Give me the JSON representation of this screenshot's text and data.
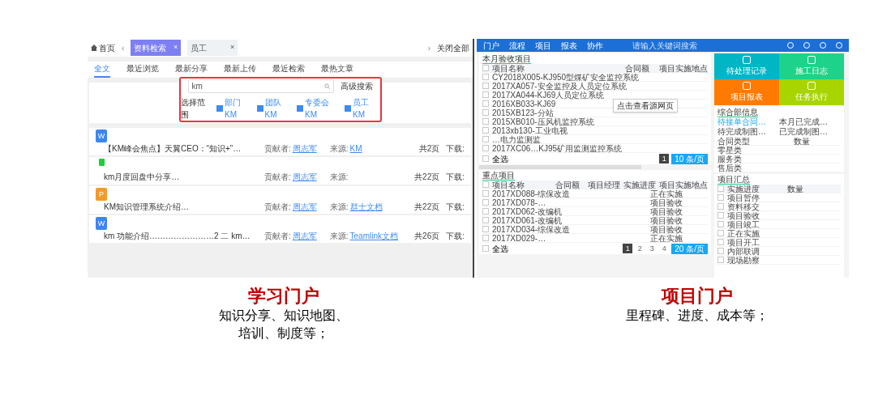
{
  "learning_portal": {
    "top_bar": {
      "home": "首页",
      "prev": "‹",
      "tabs": [
        {
          "label": "资料检索",
          "selected": true
        },
        {
          "label": "员工",
          "selected": false
        }
      ],
      "close": "×",
      "next": "›",
      "close_all": "关闭全部"
    },
    "nav": [
      {
        "label": "全文",
        "selected": true
      },
      {
        "label": "最近浏览",
        "selected": false
      },
      {
        "label": "最新分享",
        "selected": false
      },
      {
        "label": "最新上传",
        "selected": false
      },
      {
        "label": "最近检索",
        "selected": false
      },
      {
        "label": "最热文章",
        "selected": false
      }
    ],
    "search": {
      "value": "km",
      "advanced": "高级搜索",
      "scope_label": "选择范围",
      "scopes": [
        {
          "label": "部门KM",
          "checked": true
        },
        {
          "label": "团队KM",
          "checked": true
        },
        {
          "label": "专委会KM",
          "checked": true
        },
        {
          "label": "员工KM",
          "checked": true
        }
      ]
    },
    "results": [
      {
        "kind": "word",
        "badge": "W",
        "title": "【KM峰会焦点】天翼CEO：“知识+”…",
        "contributor_label": "贡献者:",
        "contributor": "周志军",
        "source_label": "来源:",
        "source": "KM",
        "pages": "共2页",
        "download": "下载:"
      },
      {
        "kind": "sheet",
        "title": "km月度回盘中分享…",
        "contributor_label": "贡献者:",
        "contributor": "周志军",
        "source_label": "来源:",
        "pages": "共22页",
        "download": "下载:"
      },
      {
        "kind": "slides",
        "badge": "P",
        "title": "KM知识管理系统介绍…",
        "contributor_label": "贡献者:",
        "contributor": "周志军",
        "source_label": "来源:",
        "source": "群士文档",
        "pages": "共22页",
        "download": "下载:"
      },
      {
        "kind": "word",
        "badge": "W",
        "title": "km 功能介绍……………………2 二 km…",
        "contributor_label": "贡献者:",
        "contributor": "周志军",
        "source_label": "来源:",
        "source": "Teamlink文档",
        "pages": "共26页",
        "download": "下载:"
      }
    ]
  },
  "project_portal": {
    "menu": [
      "门户",
      "流程",
      "项目",
      "报表",
      "协作"
    ],
    "search_placeholder": "请输入关键词搜索",
    "monthly": {
      "title": "本月验收项目",
      "header_checked": false,
      "columns": [
        "项目名称",
        "合同额",
        "项目实施地点"
      ],
      "rows": [
        {
          "name": "CY2018X005-KJ950型煤矿安全监控系统",
          "checked": false
        },
        {
          "name": "2017XA057-安全监控及人员定位系统",
          "checked": false
        },
        {
          "name": "2017XA044-KJ69人员定位系统",
          "checked": false
        },
        {
          "name": "2016XB033-KJ69",
          "checked": false
        },
        {
          "name": "2015XB123-分站",
          "checked": false
        },
        {
          "name": "2015XB010-压风机监控系统",
          "checked": false
        },
        {
          "name": "2013xb130-工业电视",
          "checked": false
        },
        {
          "name": "…电力监测监",
          "checked": false
        },
        {
          "name": "2017XC06…KJ95矿用监测监控系统",
          "checked": false
        }
      ],
      "tooltip": "点击查看源网页",
      "select_all": {
        "label": "全选",
        "checked": false
      },
      "pages": [
        {
          "label": "1",
          "selected": true
        }
      ],
      "page_size": "10 条/页"
    },
    "key": {
      "title": "重点项目",
      "header_checked": false,
      "columns": [
        "项目名称",
        "合同额",
        "项目经理",
        "实施进度",
        "项目实施地点"
      ],
      "rows": [
        {
          "name": "2017XD088-综保改造",
          "progress": "正在实施",
          "checked": false
        },
        {
          "name": "2017XD078-…",
          "progress": "项目验收",
          "checked": false
        },
        {
          "name": "2017XD062-改编机",
          "progress": "项目验收",
          "checked": false
        },
        {
          "name": "2017XD061-改编机",
          "progress": "项目验收",
          "checked": false
        },
        {
          "name": "2017XD034-综保改造",
          "progress": "项目验收",
          "checked": false
        },
        {
          "name": "2017XD029-…",
          "progress": "正在实施",
          "checked": false
        }
      ],
      "select_all": {
        "label": "全选",
        "checked": false
      },
      "pages": [
        {
          "label": "1",
          "selected": true
        },
        {
          "label": "2",
          "selected": false
        },
        {
          "label": "3",
          "selected": false
        },
        {
          "label": "4",
          "selected": false
        }
      ],
      "page_size": "20 条/页"
    },
    "tiles": [
      {
        "label": "待处理记录",
        "color": "#00b5c4"
      },
      {
        "label": "施工日志",
        "color": "#1dd28a"
      },
      {
        "label": "项目报表",
        "color": "#ff7a00"
      },
      {
        "label": "任务执行",
        "color": "#a8d400"
      }
    ],
    "dept": {
      "title": "综合部信息",
      "tabs": [
        {
          "label": "待接单合同…",
          "selected": true
        },
        {
          "label": "本月已完成…",
          "selected": false
        },
        {
          "label": "待完成制图…",
          "selected": false
        },
        {
          "label": "已完成制图…",
          "selected": false
        }
      ],
      "columns": [
        "合同类型",
        "数量"
      ],
      "rows": [
        "零星类",
        "服务类",
        "售后类"
      ]
    },
    "summary": {
      "title": "项目汇总",
      "header_checked": false,
      "columns": [
        "实施进度",
        "数量"
      ],
      "rows": [
        {
          "name": "项目暂停",
          "checked": false
        },
        {
          "name": "资料移交",
          "checked": false
        },
        {
          "name": "项目验收",
          "checked": false
        },
        {
          "name": "项目竣工",
          "checked": false
        },
        {
          "name": "正在实施",
          "checked": false
        },
        {
          "name": "项目开工",
          "checked": false
        },
        {
          "name": "内部联调",
          "checked": false
        },
        {
          "name": "现场勘察",
          "checked": false
        }
      ]
    }
  },
  "captions": [
    {
      "title": "学习门户",
      "lines": [
        "知识分享、知识地图、",
        "培训、制度等；"
      ]
    },
    {
      "title": "项目门户",
      "lines": [
        "里程碑、进度、成本等；"
      ]
    }
  ]
}
